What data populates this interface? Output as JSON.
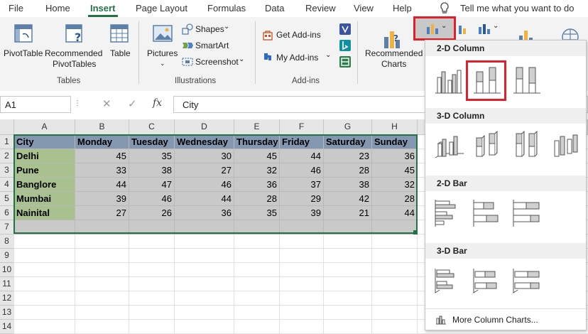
{
  "tabs": [
    "File",
    "Home",
    "Insert",
    "Page Layout",
    "Formulas",
    "Data",
    "Review",
    "View",
    "Help"
  ],
  "tell_me": "Tell me what you want to do",
  "ribbon": {
    "tables": {
      "pivottable": "PivotTable",
      "recommended1": "Recommended",
      "recommended2": "PivotTables",
      "table": "Table",
      "group": "Tables"
    },
    "illustrations": {
      "pictures": "Pictures",
      "shapes": "Shapes",
      "smartart": "SmartArt",
      "screenshot": "Screenshot",
      "group": "Illustrations"
    },
    "addins": {
      "get": "Get Add-ins",
      "my": "My Add-ins",
      "group": "Add-ins"
    },
    "charts": {
      "rec1": "Recommended",
      "rec2": "Charts"
    }
  },
  "formula_bar": {
    "name_box": "A1",
    "fx": "fx",
    "value": "City"
  },
  "columns": [
    "A",
    "B",
    "C",
    "D",
    "E",
    "F",
    "G",
    "H"
  ],
  "rows": [
    "1",
    "2",
    "3",
    "4",
    "5",
    "6",
    "7",
    "8",
    "9",
    "10",
    "11",
    "12",
    "13",
    "14"
  ],
  "table": {
    "headers": [
      "City",
      "Monday",
      "Tuesday",
      "Wednesday",
      "Thursday",
      "Friday",
      "Saturday",
      "Sunday"
    ],
    "rows": [
      [
        "Delhi",
        "45",
        "35",
        "30",
        "45",
        "44",
        "23",
        "36"
      ],
      [
        "Pune",
        "33",
        "38",
        "27",
        "32",
        "46",
        "28",
        "45"
      ],
      [
        "Banglore",
        "44",
        "47",
        "46",
        "36",
        "37",
        "38",
        "32"
      ],
      [
        "Mumbai",
        "39",
        "46",
        "44",
        "28",
        "29",
        "42",
        "28"
      ],
      [
        "Nainital",
        "27",
        "26",
        "36",
        "35",
        "39",
        "21",
        "44"
      ]
    ]
  },
  "dropdown": {
    "section_2d_column": "2-D Column",
    "section_3d_column": "3-D Column",
    "section_2d_bar": "2-D Bar",
    "section_3d_bar": "3-D Bar",
    "more": "More Column Charts..."
  },
  "colors": {
    "accent": "#217346",
    "highlight": "#e0202a",
    "header_fill": "#8497b0",
    "city_fill": "#a9c08f",
    "value_fill": "#c9c9c9"
  }
}
